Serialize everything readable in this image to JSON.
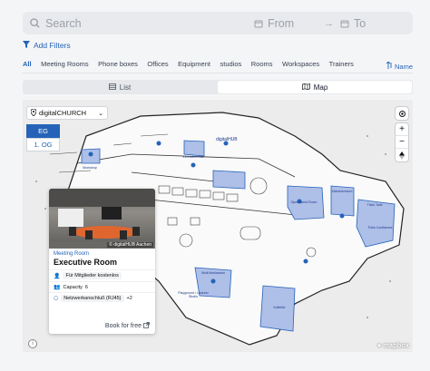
{
  "search": {
    "placeholder": "Search",
    "from": "From",
    "arrow": "→",
    "to": "To"
  },
  "filters": {
    "label": "Add Filters"
  },
  "tabs": [
    {
      "label": "All",
      "active": true
    },
    {
      "label": "Meeting Rooms"
    },
    {
      "label": "Phone boxes"
    },
    {
      "label": "Offices"
    },
    {
      "label": "Equipment"
    },
    {
      "label": "studios"
    },
    {
      "label": "Rooms"
    },
    {
      "label": "Workspaces"
    },
    {
      "label": "Trainers"
    }
  ],
  "sort": {
    "label": "Name"
  },
  "view": {
    "list": "List",
    "map": "Map",
    "selected": "Map"
  },
  "map": {
    "venue": "digitalCHURCH",
    "floors": [
      {
        "label": "EG",
        "active": true
      },
      {
        "label": "1. OG"
      }
    ],
    "zoom_in": "+",
    "zoom_out": "−",
    "attribution": "mapbox",
    "building_label": "digitalHUB",
    "room_labels": [
      "Open World Room",
      "Zwischenraum",
      "Think Tank",
      "Think Confidence",
      "Multi Mediaraum",
      "Playground / Lecturer Studio",
      "Kollektiv",
      "Innovation Lab",
      "Workshop"
    ]
  },
  "card": {
    "type": "Meeting Room",
    "title": "Executive Room",
    "photo_credit": "© digitalHUB Aachen",
    "features": [
      {
        "icon": "person-icon",
        "label": "Für Mitglieder kostenlos"
      },
      {
        "icon": "people-icon",
        "label": "Capacity",
        "value": "6"
      },
      {
        "icon": "network-icon",
        "label": "Netzwerkanschluß (RJ45)",
        "extra": "+2"
      }
    ],
    "book_label": "Book for free"
  },
  "colors": {
    "accent": "#2563b8",
    "room_fill": "#aebfe8",
    "room_stroke": "#2563b8"
  }
}
